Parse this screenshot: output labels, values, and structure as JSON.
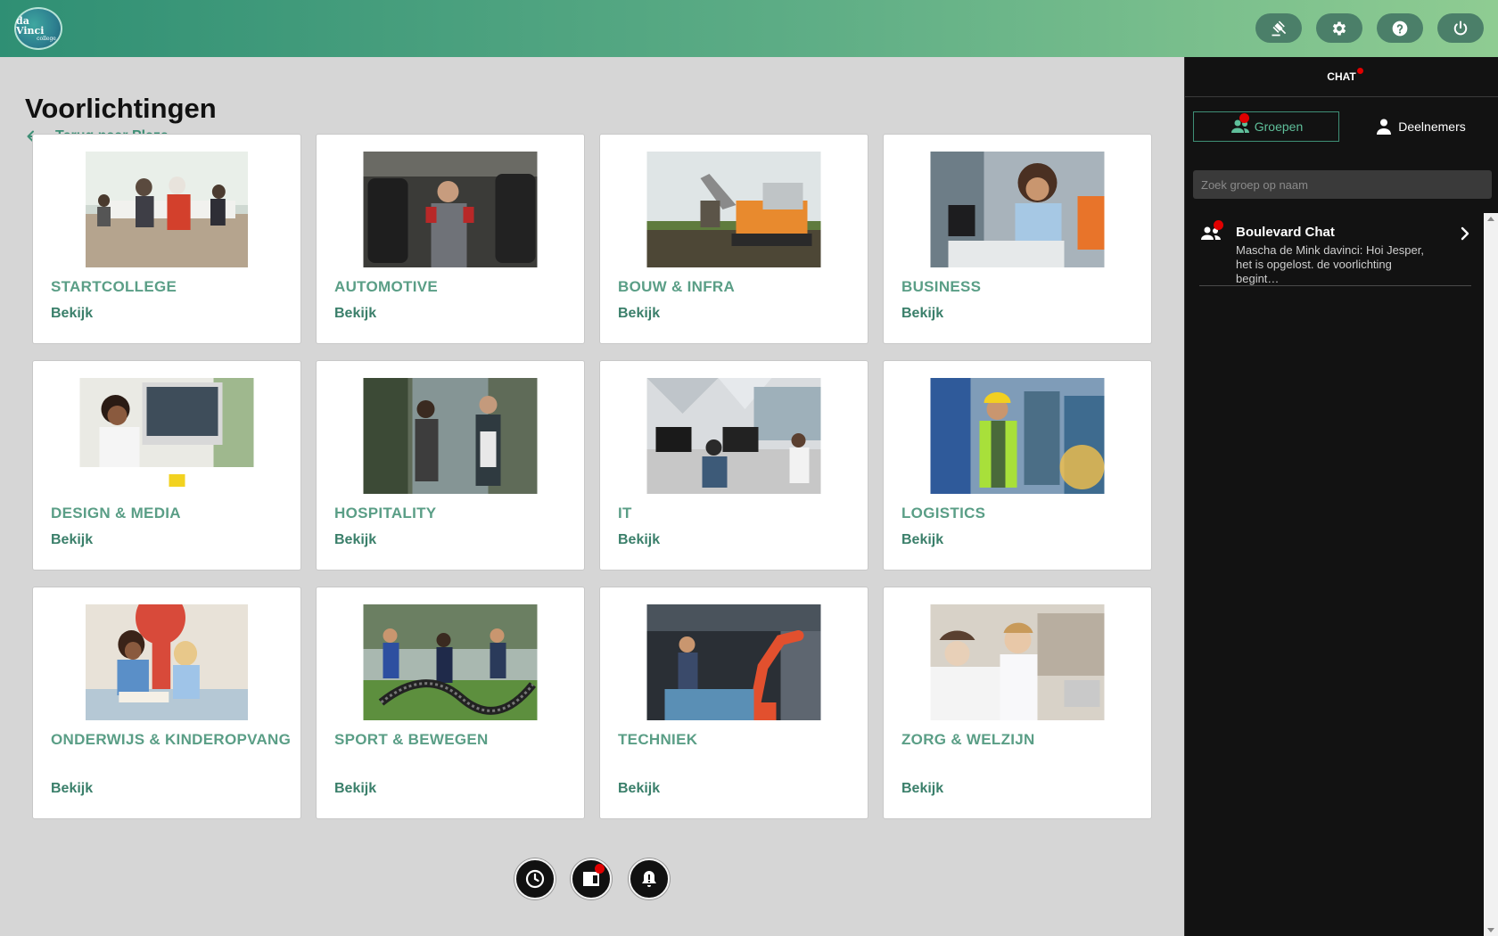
{
  "header": {
    "logo_text": "da Vinci",
    "logo_sub": "college",
    "buttons": [
      {
        "icon": "gavel-icon"
      },
      {
        "icon": "gear-icon"
      },
      {
        "icon": "help-icon"
      },
      {
        "icon": "power-icon"
      }
    ]
  },
  "main": {
    "title": "Voorlichtingen",
    "back_label": "Terug naar Plaza",
    "cards": [
      {
        "title": "STARTCOLLEGE",
        "view": "Bekijk"
      },
      {
        "title": "AUTOMOTIVE",
        "view": "Bekijk"
      },
      {
        "title": "BOUW & INFRA",
        "view": "Bekijk"
      },
      {
        "title": "BUSINESS",
        "view": "Bekijk"
      },
      {
        "title": "DESIGN & MEDIA",
        "view": "Bekijk"
      },
      {
        "title": "HOSPITALITY",
        "view": "Bekijk"
      },
      {
        "title": "IT",
        "view": "Bekijk"
      },
      {
        "title": "LOGISTICS",
        "view": "Bekijk"
      },
      {
        "title": "ONDERWIJS & KINDEROPVANG",
        "view": "Bekijk"
      },
      {
        "title": "SPORT & BEWEGEN",
        "view": "Bekijk"
      },
      {
        "title": "TECHNIEK",
        "view": "Bekijk"
      },
      {
        "title": "ZORG & WELZIJN",
        "view": "Bekijk"
      }
    ]
  },
  "floating": [
    {
      "icon": "clock-icon"
    },
    {
      "icon": "agenda-icon"
    },
    {
      "icon": "bell-alert-icon"
    }
  ],
  "chat": {
    "title": "CHAT",
    "tabs": {
      "groups": "Groepen",
      "participants": "Deelnemers"
    },
    "search_placeholder": "Zoek groep op naam",
    "items": [
      {
        "name": "Boulevard Chat",
        "message": "Mascha de Mink davinci: Hoi Jesper, het is opgelost. de voorlichting begint…"
      }
    ]
  },
  "colors": {
    "accent": "#3f8f76",
    "card_title": "#5a9e86",
    "notification": "#e00000",
    "sidebar_bg": "#121212"
  }
}
